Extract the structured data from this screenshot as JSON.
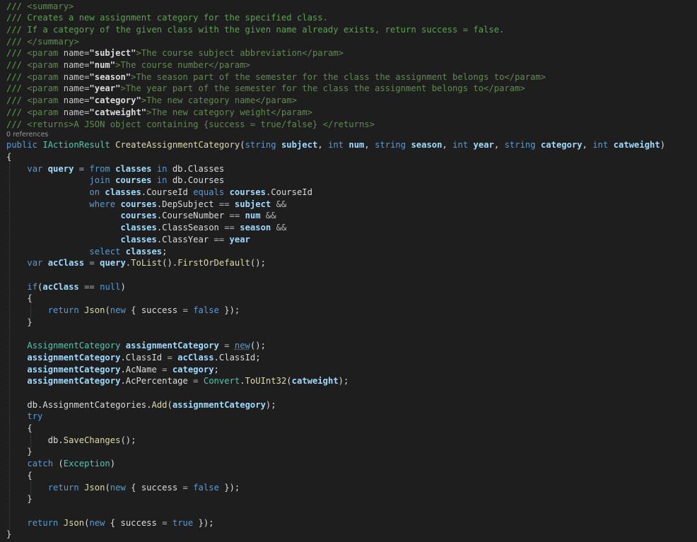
{
  "editor": {
    "codelens": "0 references",
    "lines": [
      [
        [
          "/// ",
          "comment"
        ],
        [
          "<summary>",
          "xmltag"
        ]
      ],
      [
        [
          "/// Creates a new assignment category for the specified class.",
          "comment"
        ]
      ],
      [
        [
          "/// If a category of the given class with the given name already exists, return success = false.",
          "comment"
        ]
      ],
      [
        [
          "/// ",
          "comment"
        ],
        [
          "</summary>",
          "xmltag"
        ]
      ],
      [
        [
          "/// ",
          "comment"
        ],
        [
          "<param ",
          "xmltag"
        ],
        [
          "name=",
          "attr"
        ],
        [
          "\"subject\"",
          "attrval"
        ],
        [
          ">The course subject abbreviation</param>",
          "xmltag"
        ]
      ],
      [
        [
          "/// ",
          "comment"
        ],
        [
          "<param ",
          "xmltag"
        ],
        [
          "name=",
          "attr"
        ],
        [
          "\"num\"",
          "attrval"
        ],
        [
          ">The course number</param>",
          "xmltag"
        ]
      ],
      [
        [
          "/// ",
          "comment"
        ],
        [
          "<param ",
          "xmltag"
        ],
        [
          "name=",
          "attr"
        ],
        [
          "\"season\"",
          "attrval"
        ],
        [
          ">The season part of the semester for the class the assignment belongs to</param>",
          "xmltag"
        ]
      ],
      [
        [
          "/// ",
          "comment"
        ],
        [
          "<param ",
          "xmltag"
        ],
        [
          "name=",
          "attr"
        ],
        [
          "\"year\"",
          "attrval"
        ],
        [
          ">The year part of the semester for the class the assignment belongs to</param>",
          "xmltag"
        ]
      ],
      [
        [
          "/// ",
          "comment"
        ],
        [
          "<param ",
          "xmltag"
        ],
        [
          "name=",
          "attr"
        ],
        [
          "\"category\"",
          "attrval"
        ],
        [
          ">The new category name</param>",
          "xmltag"
        ]
      ],
      [
        [
          "/// ",
          "comment"
        ],
        [
          "<param ",
          "xmltag"
        ],
        [
          "name=",
          "attr"
        ],
        [
          "\"catweight\"",
          "attrval"
        ],
        [
          ">The new category weight</param>",
          "xmltag"
        ]
      ],
      [
        [
          "/// ",
          "comment"
        ],
        [
          "<returns>A JSON object containing {success = true/false} </returns>",
          "xmltag"
        ]
      ],
      [
        [
          "public ",
          "kw"
        ],
        [
          "IActionResult ",
          "type"
        ],
        [
          "CreateAssignmentCategory",
          "method"
        ],
        [
          "(",
          "punct"
        ],
        [
          "string ",
          "kw"
        ],
        [
          "subject",
          "param"
        ],
        [
          ", ",
          "punct"
        ],
        [
          "int ",
          "kw"
        ],
        [
          "num",
          "param"
        ],
        [
          ", ",
          "punct"
        ],
        [
          "string ",
          "kw"
        ],
        [
          "season",
          "param"
        ],
        [
          ", ",
          "punct"
        ],
        [
          "int ",
          "kw"
        ],
        [
          "year",
          "param"
        ],
        [
          ", ",
          "punct"
        ],
        [
          "string ",
          "kw"
        ],
        [
          "category",
          "param"
        ],
        [
          ", ",
          "punct"
        ],
        [
          "int ",
          "kw"
        ],
        [
          "catweight",
          "param"
        ],
        [
          ")",
          "punct"
        ]
      ],
      [
        [
          "{",
          "punct"
        ]
      ],
      [
        [
          "    ",
          "plain"
        ],
        [
          "var ",
          "kw"
        ],
        [
          "query",
          "local"
        ],
        [
          " = ",
          "op"
        ],
        [
          "from ",
          "kw"
        ],
        [
          "classes ",
          "local"
        ],
        [
          "in ",
          "kw"
        ],
        [
          "db",
          "member"
        ],
        [
          ".",
          "punct"
        ],
        [
          "Classes",
          "member"
        ]
      ],
      [
        [
          "                ",
          "plain"
        ],
        [
          "join ",
          "kw"
        ],
        [
          "courses ",
          "local"
        ],
        [
          "in ",
          "kw"
        ],
        [
          "db",
          "member"
        ],
        [
          ".",
          "punct"
        ],
        [
          "Courses",
          "member"
        ]
      ],
      [
        [
          "                ",
          "plain"
        ],
        [
          "on ",
          "kw"
        ],
        [
          "classes",
          "local"
        ],
        [
          ".",
          "punct"
        ],
        [
          "CourseId ",
          "member"
        ],
        [
          "equals ",
          "kw"
        ],
        [
          "courses",
          "local"
        ],
        [
          ".",
          "punct"
        ],
        [
          "CourseId",
          "member"
        ]
      ],
      [
        [
          "                ",
          "plain"
        ],
        [
          "where ",
          "kw"
        ],
        [
          "courses",
          "local"
        ],
        [
          ".",
          "punct"
        ],
        [
          "DepSubject ",
          "member"
        ],
        [
          "== ",
          "op"
        ],
        [
          "subject ",
          "param"
        ],
        [
          "&&",
          "op"
        ]
      ],
      [
        [
          "                      ",
          "plain"
        ],
        [
          "courses",
          "local"
        ],
        [
          ".",
          "punct"
        ],
        [
          "CourseNumber ",
          "member"
        ],
        [
          "== ",
          "op"
        ],
        [
          "num ",
          "param"
        ],
        [
          "&&",
          "op"
        ]
      ],
      [
        [
          "                      ",
          "plain"
        ],
        [
          "classes",
          "local"
        ],
        [
          ".",
          "punct"
        ],
        [
          "ClassSeason ",
          "member"
        ],
        [
          "== ",
          "op"
        ],
        [
          "season ",
          "param"
        ],
        [
          "&&",
          "op"
        ]
      ],
      [
        [
          "                      ",
          "plain"
        ],
        [
          "classes",
          "local"
        ],
        [
          ".",
          "punct"
        ],
        [
          "ClassYear ",
          "member"
        ],
        [
          "== ",
          "op"
        ],
        [
          "year",
          "param"
        ]
      ],
      [
        [
          "                ",
          "plain"
        ],
        [
          "select ",
          "kw"
        ],
        [
          "classes",
          "local"
        ],
        [
          ";",
          "punct"
        ]
      ],
      [
        [
          "    ",
          "plain"
        ],
        [
          "var ",
          "kw"
        ],
        [
          "acClass",
          "local"
        ],
        [
          " = ",
          "op"
        ],
        [
          "query",
          "local"
        ],
        [
          ".",
          "punct"
        ],
        [
          "ToList",
          "method"
        ],
        [
          "().",
          "punct"
        ],
        [
          "FirstOrDefault",
          "method"
        ],
        [
          "();",
          "punct"
        ]
      ],
      [],
      [
        [
          "    ",
          "plain"
        ],
        [
          "if",
          "kw"
        ],
        [
          "(",
          "punct"
        ],
        [
          "acClass ",
          "local"
        ],
        [
          "== ",
          "op"
        ],
        [
          "null",
          "kw"
        ],
        [
          ")",
          "punct"
        ]
      ],
      [
        [
          "    ",
          "plain"
        ],
        [
          "{",
          "punct"
        ]
      ],
      [
        [
          "        ",
          "plain"
        ],
        [
          "return ",
          "kw"
        ],
        [
          "Json",
          "method"
        ],
        [
          "(",
          "punct"
        ],
        [
          "new ",
          "kw"
        ],
        [
          "{ ",
          "punct"
        ],
        [
          "success ",
          "member"
        ],
        [
          "= ",
          "op"
        ],
        [
          "false ",
          "kw"
        ],
        [
          "});",
          "punct"
        ]
      ],
      [
        [
          "    ",
          "plain"
        ],
        [
          "}",
          "punct"
        ]
      ],
      [],
      [
        [
          "    ",
          "plain"
        ],
        [
          "AssignmentCategory ",
          "type"
        ],
        [
          "assignmentCategory",
          "local"
        ],
        [
          " = ",
          "op"
        ],
        [
          "new",
          "kw-squiggle"
        ],
        [
          "();",
          "punct"
        ]
      ],
      [
        [
          "    ",
          "plain"
        ],
        [
          "assignmentCategory",
          "local"
        ],
        [
          ".",
          "punct"
        ],
        [
          "ClassId",
          "member"
        ],
        [
          " = ",
          "op"
        ],
        [
          "acClass",
          "local"
        ],
        [
          ".",
          "punct"
        ],
        [
          "ClassId",
          "member"
        ],
        [
          ";",
          "punct"
        ]
      ],
      [
        [
          "    ",
          "plain"
        ],
        [
          "assignmentCategory",
          "local"
        ],
        [
          ".",
          "punct"
        ],
        [
          "AcName",
          "member"
        ],
        [
          " = ",
          "op"
        ],
        [
          "category",
          "param"
        ],
        [
          ";",
          "punct"
        ]
      ],
      [
        [
          "    ",
          "plain"
        ],
        [
          "assignmentCategory",
          "local"
        ],
        [
          ".",
          "punct"
        ],
        [
          "AcPercentage",
          "member"
        ],
        [
          " = ",
          "op"
        ],
        [
          "Convert",
          "type"
        ],
        [
          ".",
          "punct"
        ],
        [
          "ToUInt32",
          "method"
        ],
        [
          "(",
          "punct"
        ],
        [
          "catweight",
          "param"
        ],
        [
          ");",
          "punct"
        ]
      ],
      [],
      [
        [
          "    ",
          "plain"
        ],
        [
          "db",
          "member"
        ],
        [
          ".",
          "punct"
        ],
        [
          "AssignmentCategories",
          "member"
        ],
        [
          ".",
          "punct"
        ],
        [
          "Add",
          "method"
        ],
        [
          "(",
          "punct"
        ],
        [
          "assignmentCategory",
          "local"
        ],
        [
          ");",
          "punct"
        ]
      ],
      [
        [
          "    ",
          "plain"
        ],
        [
          "try",
          "kw"
        ]
      ],
      [
        [
          "    ",
          "plain"
        ],
        [
          "{",
          "punct"
        ]
      ],
      [
        [
          "        ",
          "plain"
        ],
        [
          "db",
          "member"
        ],
        [
          ".",
          "punct"
        ],
        [
          "SaveChanges",
          "method"
        ],
        [
          "();",
          "punct"
        ]
      ],
      [
        [
          "    ",
          "plain"
        ],
        [
          "}",
          "punct"
        ]
      ],
      [
        [
          "    ",
          "plain"
        ],
        [
          "catch ",
          "kw"
        ],
        [
          "(",
          "punct"
        ],
        [
          "Exception",
          "type"
        ],
        [
          ")",
          "punct"
        ]
      ],
      [
        [
          "    ",
          "plain"
        ],
        [
          "{",
          "punct"
        ]
      ],
      [
        [
          "        ",
          "plain"
        ],
        [
          "return ",
          "kw"
        ],
        [
          "Json",
          "method"
        ],
        [
          "(",
          "punct"
        ],
        [
          "new ",
          "kw"
        ],
        [
          "{ ",
          "punct"
        ],
        [
          "success ",
          "member"
        ],
        [
          "= ",
          "op"
        ],
        [
          "false ",
          "kw"
        ],
        [
          "});",
          "punct"
        ]
      ],
      [
        [
          "    ",
          "plain"
        ],
        [
          "}",
          "punct"
        ]
      ],
      [],
      [
        [
          "    ",
          "plain"
        ],
        [
          "return ",
          "kw"
        ],
        [
          "Json",
          "method"
        ],
        [
          "(",
          "punct"
        ],
        [
          "new ",
          "kw"
        ],
        [
          "{ ",
          "punct"
        ],
        [
          "success ",
          "member"
        ],
        [
          "= ",
          "op"
        ],
        [
          "true ",
          "kw"
        ],
        [
          "});",
          "punct"
        ]
      ],
      [
        [
          "}",
          "punct"
        ]
      ]
    ]
  },
  "colors": {
    "background": "#1e1e1e",
    "comment": "#57a64a",
    "keyword": "#569cd6",
    "type": "#4ec9b0",
    "method": "#dcdcaa",
    "identifier": "#9cdcfe"
  }
}
